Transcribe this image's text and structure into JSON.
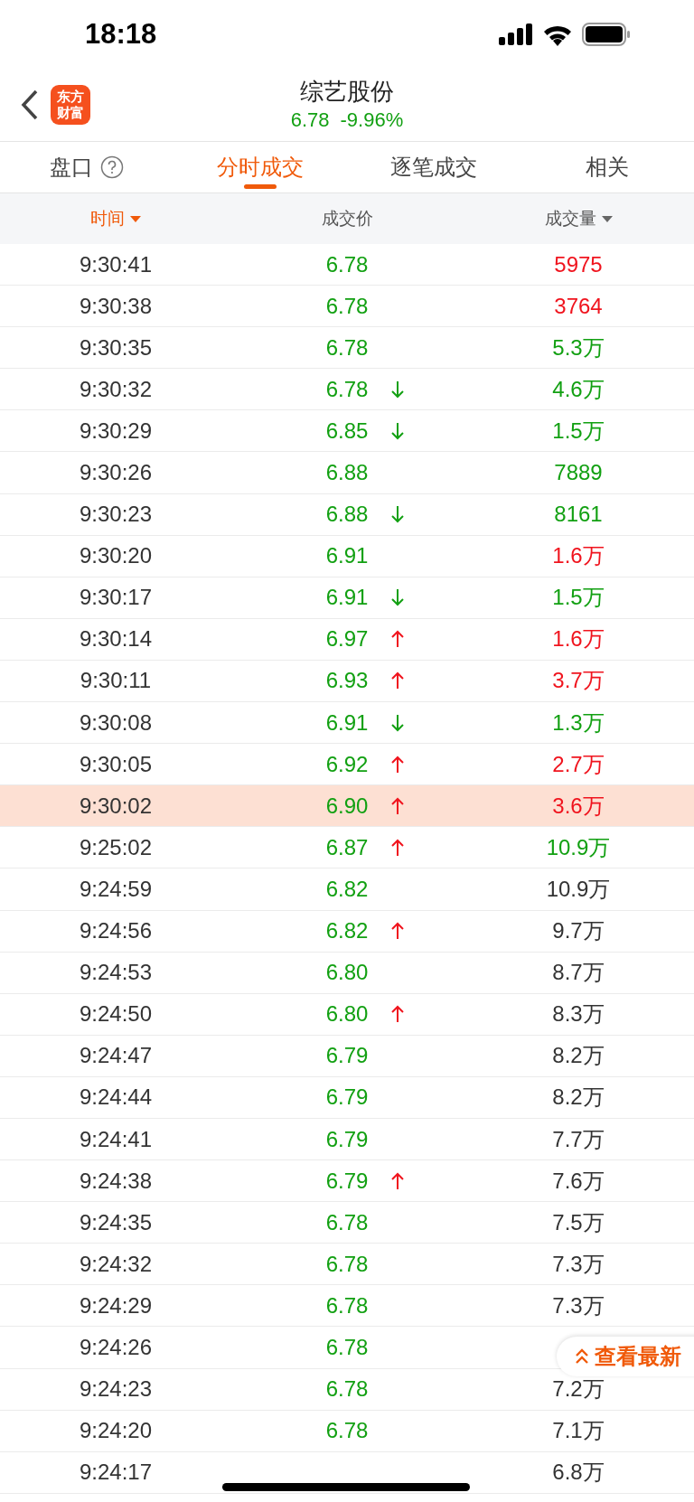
{
  "status_bar": {
    "time": "18:18"
  },
  "header": {
    "logo": [
      "东方",
      "财富"
    ],
    "title": "综艺股份",
    "price": "6.78",
    "change": "-9.96%"
  },
  "tabs": [
    {
      "label": "盘口",
      "help": true,
      "selected": false
    },
    {
      "label": "分时成交",
      "selected": true
    },
    {
      "label": "逐笔成交",
      "selected": false
    },
    {
      "label": "相关",
      "selected": false
    }
  ],
  "columns": [
    {
      "label": "时间",
      "sorted": true,
      "sortable": true
    },
    {
      "label": "成交价",
      "sorted": false
    },
    {
      "label": "成交量",
      "sorted": false,
      "sortable": true
    }
  ],
  "rows": [
    {
      "time": "9:30:41",
      "price": "6.78",
      "volume": {
        "text": "5975",
        "color": "#f0141e"
      },
      "selected": false
    },
    {
      "time": "9:30:38",
      "price": "6.78",
      "volume": {
        "text": "3764",
        "color": "#f0141e"
      },
      "selected": false
    },
    {
      "time": "9:30:35",
      "price": "6.78",
      "volume": {
        "text": "5.3万",
        "color": "#12a012"
      },
      "selected": false
    },
    {
      "time": "9:30:32",
      "price": "6.78",
      "rising": false,
      "volume": {
        "text": "4.6万",
        "color": "#12a012"
      },
      "selected": false
    },
    {
      "time": "9:30:29",
      "price": "6.85",
      "rising": false,
      "volume": {
        "text": "1.5万",
        "color": "#12a012"
      },
      "selected": false
    },
    {
      "time": "9:30:26",
      "price": "6.88",
      "volume": {
        "text": "7889",
        "color": "#12a012"
      },
      "selected": false
    },
    {
      "time": "9:30:23",
      "price": "6.88",
      "rising": false,
      "volume": {
        "text": "8161",
        "color": "#12a012"
      },
      "selected": false
    },
    {
      "time": "9:30:20",
      "price": "6.91",
      "volume": {
        "text": "1.6万",
        "color": "#f0141e"
      },
      "selected": false
    },
    {
      "time": "9:30:17",
      "price": "6.91",
      "rising": false,
      "volume": {
        "text": "1.5万",
        "color": "#12a012"
      },
      "selected": false
    },
    {
      "time": "9:30:14",
      "price": "6.97",
      "rising": true,
      "volume": {
        "text": "1.6万",
        "color": "#f0141e"
      },
      "selected": false
    },
    {
      "time": "9:30:11",
      "price": "6.93",
      "rising": true,
      "volume": {
        "text": "3.7万",
        "color": "#f0141e"
      },
      "selected": false
    },
    {
      "time": "9:30:08",
      "price": "6.91",
      "rising": false,
      "volume": {
        "text": "1.3万",
        "color": "#12a012"
      },
      "selected": false
    },
    {
      "time": "9:30:05",
      "price": "6.92",
      "rising": true,
      "volume": {
        "text": "2.7万",
        "color": "#f0141e"
      },
      "selected": false
    },
    {
      "time": "9:30:02",
      "price": "6.90",
      "rising": true,
      "volume": {
        "text": "3.6万",
        "color": "#f0141e"
      },
      "selected": true
    },
    {
      "time": "9:25:02",
      "price": "6.87",
      "rising": true,
      "volume": {
        "text": "10.9万",
        "color": "#12a012"
      },
      "selected": false
    },
    {
      "time": "9:24:59",
      "price": "6.82",
      "volume": {
        "text": "10.9万",
        "color": "#333333"
      },
      "selected": false
    },
    {
      "time": "9:24:56",
      "price": "6.82",
      "rising": true,
      "volume": {
        "text": "9.7万",
        "color": "#333333"
      },
      "selected": false
    },
    {
      "time": "9:24:53",
      "price": "6.80",
      "volume": {
        "text": "8.7万",
        "color": "#333333"
      },
      "selected": false
    },
    {
      "time": "9:24:50",
      "price": "6.80",
      "rising": true,
      "volume": {
        "text": "8.3万",
        "color": "#333333"
      },
      "selected": false
    },
    {
      "time": "9:24:47",
      "price": "6.79",
      "volume": {
        "text": "8.2万",
        "color": "#333333"
      },
      "selected": false
    },
    {
      "time": "9:24:44",
      "price": "6.79",
      "volume": {
        "text": "8.2万",
        "color": "#333333"
      },
      "selected": false
    },
    {
      "time": "9:24:41",
      "price": "6.79",
      "volume": {
        "text": "7.7万",
        "color": "#333333"
      },
      "selected": false
    },
    {
      "time": "9:24:38",
      "price": "6.79",
      "rising": true,
      "volume": {
        "text": "7.6万",
        "color": "#333333"
      },
      "selected": false
    },
    {
      "time": "9:24:35",
      "price": "6.78",
      "volume": {
        "text": "7.5万",
        "color": "#333333"
      },
      "selected": false
    },
    {
      "time": "9:24:32",
      "price": "6.78",
      "volume": {
        "text": "7.3万",
        "color": "#333333"
      },
      "selected": false
    },
    {
      "time": "9:24:29",
      "price": "6.78",
      "volume": {
        "text": "7.3万",
        "color": "#333333"
      },
      "selected": false
    },
    {
      "time": "9:24:26",
      "price": "6.78",
      "selected": false
    },
    {
      "time": "9:24:23",
      "price": "6.78",
      "volume": {
        "text": "7.2万",
        "color": "#333333"
      },
      "selected": false
    },
    {
      "time": "9:24:20",
      "price": "6.78",
      "volume": {
        "text": "7.1万",
        "color": "#333333"
      },
      "selected": false
    },
    {
      "time": "9:24:17",
      "volume": {
        "text": "6.8万",
        "color": "#333333"
      },
      "selected": false
    }
  ],
  "latest_button": {
    "label": "查看最新"
  }
}
